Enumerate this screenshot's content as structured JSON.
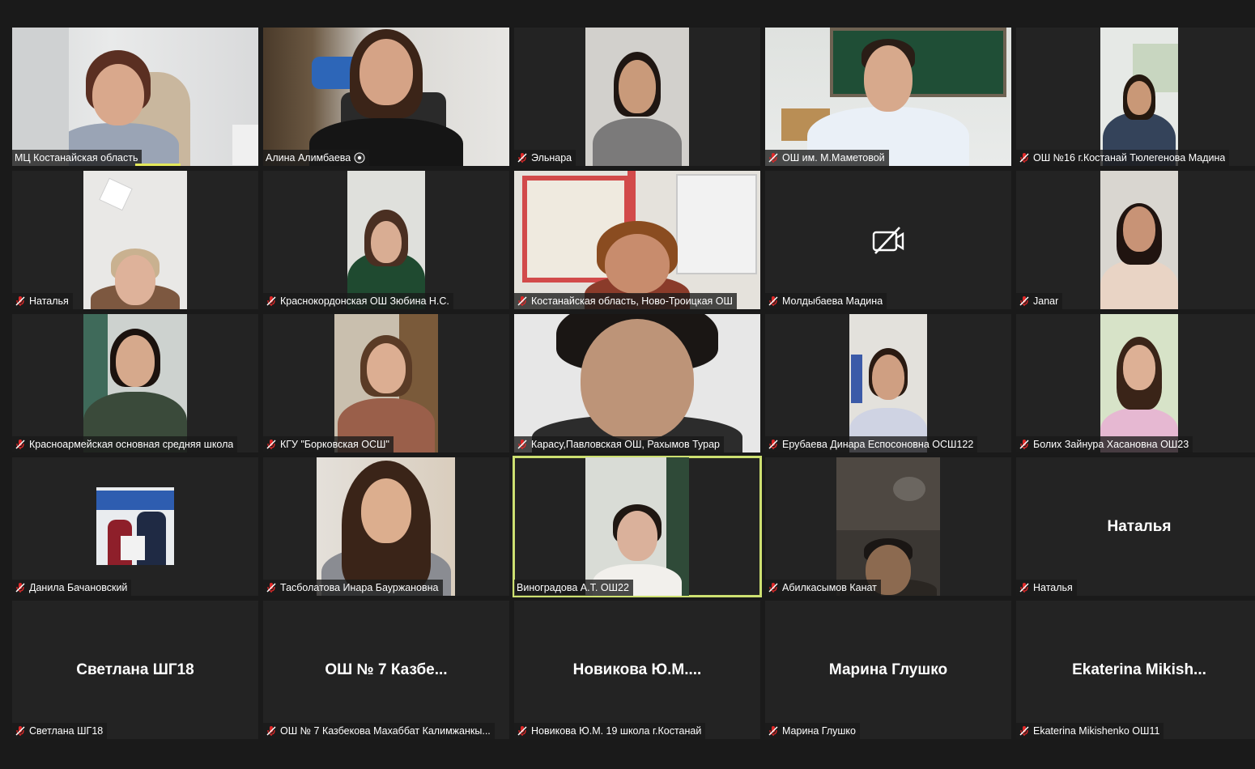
{
  "tiles": [
    {
      "label": "МЦ Костанайская область",
      "muted": false,
      "video": true,
      "speaking_bar": true
    },
    {
      "label": "Алина Алимбаева",
      "muted": false,
      "video": true,
      "extra_icon": "screen-share-icon"
    },
    {
      "label": "Эльнара",
      "muted": true,
      "video": true
    },
    {
      "label": "ОШ им. М.Маметовой",
      "muted": true,
      "video": true
    },
    {
      "label": "ОШ №16 г.Костанай Тюлегенова Мадина",
      "muted": true,
      "video": true
    },
    {
      "label": "Наталья",
      "muted": true,
      "video": true
    },
    {
      "label": "Краснокордонская ОШ Зюбина Н.С.",
      "muted": true,
      "video": true
    },
    {
      "label": "Костанайская область, Ново-Троицкая ОШ",
      "muted": true,
      "video": true
    },
    {
      "label": "Молдыбаева Мадина",
      "muted": true,
      "video": false,
      "camera_off_icon": "camera-off-icon"
    },
    {
      "label": " Janar",
      "muted": true,
      "video": true
    },
    {
      "label": "Красноармейская основная средняя школа",
      "muted": true,
      "video": true
    },
    {
      "label": "КГУ \"Борковская ОСШ\"",
      "muted": true,
      "video": true
    },
    {
      "label": "Карасу,Павловская ОШ, Рахымов Турар",
      "muted": true,
      "video": true
    },
    {
      "label": "Ерубаева Динара Еспосоновна ОСШ122",
      "muted": true,
      "video": true
    },
    {
      "label": "Болих Зайнура Хасановна ОШ23",
      "muted": true,
      "video": true
    },
    {
      "label": "Данила Бачановский",
      "muted": true,
      "video": true
    },
    {
      "label": "Тасболатова Инара Бауржановна",
      "muted": true,
      "video": true
    },
    {
      "label": "Виноградова А.Т. ОШ22",
      "muted": false,
      "video": true,
      "active_speaker": true
    },
    {
      "label": "Абилкасымов Канат",
      "muted": true,
      "video": true
    },
    {
      "label": "Наталья",
      "muted": true,
      "video": false,
      "display_name": "Наталья"
    },
    {
      "label": "Светлана ШГ18",
      "muted": true,
      "video": false,
      "display_name": "Светлана ШГ18"
    },
    {
      "label": "ОШ № 7  Казбекова Махаббат Калимжанкы...",
      "muted": true,
      "video": false,
      "display_name": "ОШ № 7  Казбе..."
    },
    {
      "label": "Новикова Ю.М. 19 школа г.Костанай",
      "muted": true,
      "video": false,
      "display_name": "Новикова  Ю.М...."
    },
    {
      "label": "Марина Глушко",
      "muted": true,
      "video": false,
      "display_name": "Марина Глушко"
    },
    {
      "label": "Ekaterina Mikishenko ОШ11",
      "muted": true,
      "video": false,
      "display_name": "Ekaterina  Mikish..."
    }
  ],
  "colors": {
    "background": "#1a1a1a",
    "tile": "#232323",
    "muted": "#e02828",
    "active_speaker_border": "#cde071",
    "speaking_bar": "#e4e85a"
  }
}
